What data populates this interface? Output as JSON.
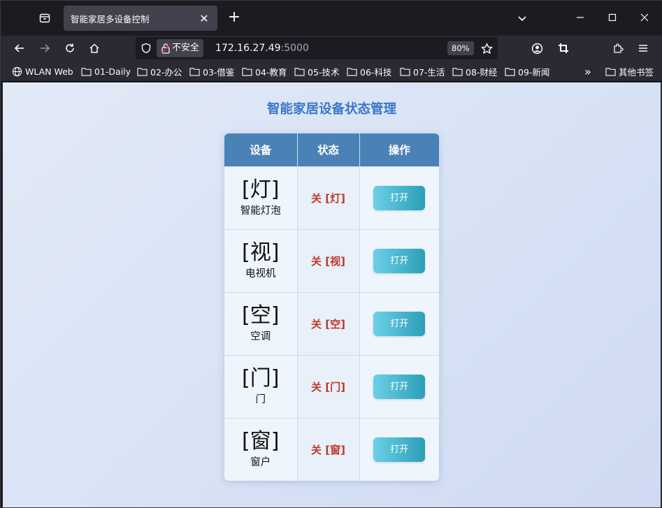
{
  "browser": {
    "tab": {
      "title": "智能家居多设备控制",
      "close": "✕"
    },
    "new_tab": "+",
    "url": {
      "insecure_label": "不安全",
      "host": "172.16.27.49",
      "port": ":5000",
      "zoom": "80%"
    },
    "bookmarks": [
      {
        "label": "WLAN Web",
        "icon": "globe-icon"
      },
      {
        "label": "01-Daily",
        "icon": "folder-icon"
      },
      {
        "label": "02-办公",
        "icon": "folder-icon"
      },
      {
        "label": "03-借鉴",
        "icon": "folder-icon"
      },
      {
        "label": "04-教育",
        "icon": "folder-icon"
      },
      {
        "label": "05-技术",
        "icon": "folder-icon"
      },
      {
        "label": "06-科技",
        "icon": "folder-icon"
      },
      {
        "label": "07-生活",
        "icon": "folder-icon"
      },
      {
        "label": "08-财经",
        "icon": "folder-icon"
      },
      {
        "label": "09-新闻",
        "icon": "folder-icon"
      }
    ],
    "bookmarks_overflow": "»",
    "other_bookmarks": "其他书签"
  },
  "page": {
    "title": "智能家居设备状态管理",
    "headers": [
      "设备",
      "状态",
      "操作"
    ],
    "devices": [
      {
        "icon": "[灯]",
        "name": "智能灯泡",
        "status": "关 [灯]",
        "action": "打开"
      },
      {
        "icon": "[视]",
        "name": "电视机",
        "status": "关 [视]",
        "action": "打开"
      },
      {
        "icon": "[空]",
        "name": "空调",
        "status": "关 [空]",
        "action": "打开"
      },
      {
        "icon": "[门]",
        "name": "门",
        "status": "关 [门]",
        "action": "打开"
      },
      {
        "icon": "[窗]",
        "name": "窗户",
        "status": "关 [窗]",
        "action": "打开"
      }
    ]
  },
  "colors": {
    "title": "#3a77c9",
    "header_bg": "#4a82b7",
    "status_off": "#c0392b",
    "button_start": "#6bd0e6",
    "button_end": "#2c9fb8"
  }
}
